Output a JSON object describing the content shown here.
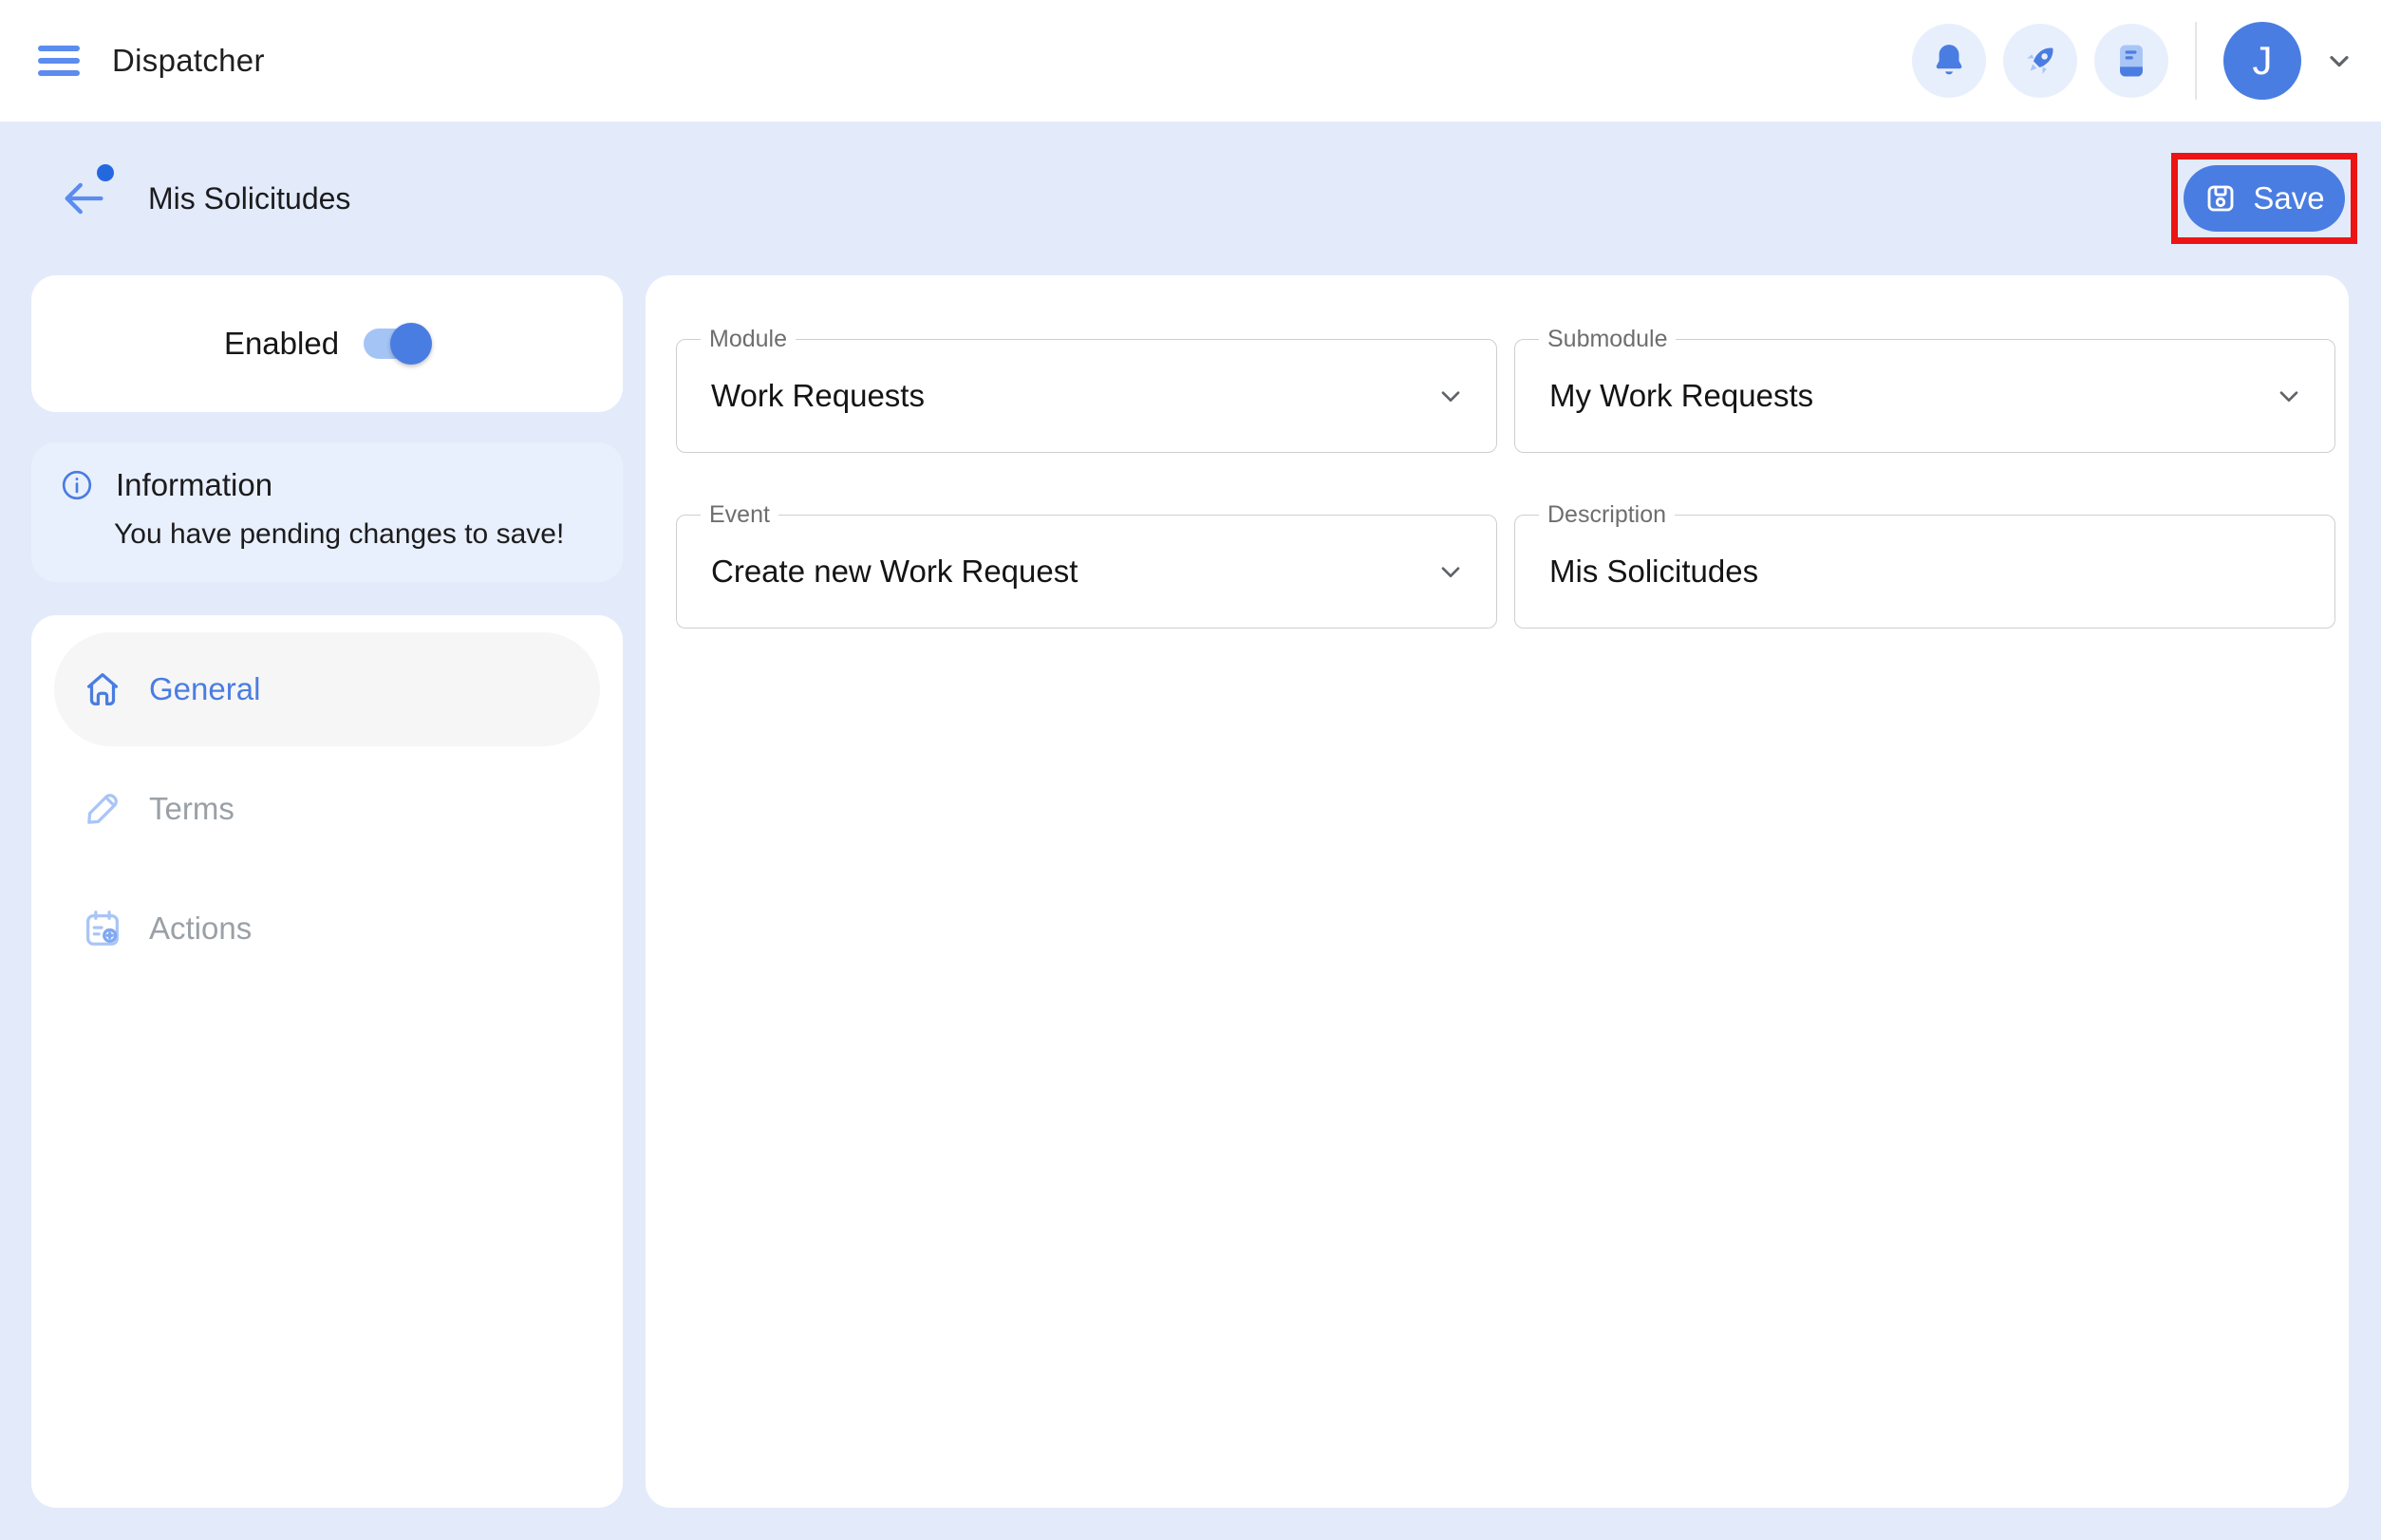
{
  "app": {
    "title": "Dispatcher",
    "avatar_initial": "J"
  },
  "page": {
    "title": "Mis Solicitudes",
    "save_button": "Save"
  },
  "sidebar": {
    "enabled_toggle": {
      "label": "Enabled",
      "state": "on"
    },
    "info_card": {
      "title": "Information",
      "message": "You have pending changes to save!"
    },
    "nav": {
      "items": [
        {
          "label": "General",
          "icon": "home-icon",
          "active": true
        },
        {
          "label": "Terms",
          "icon": "pencil-icon",
          "active": false
        },
        {
          "label": "Actions",
          "icon": "calendar-plus-icon",
          "active": false
        }
      ]
    }
  },
  "form": {
    "fields": [
      {
        "label": "Module",
        "value": "Work Requests",
        "control": "select"
      },
      {
        "label": "Submodule",
        "value": "My Work Requests",
        "control": "select"
      },
      {
        "label": "Event",
        "value": "Create new Work Request",
        "control": "select"
      },
      {
        "label": "Description",
        "value": "Mis Solicitudes",
        "control": "text-input"
      }
    ]
  },
  "icons": {
    "appbar": [
      "menu-icon",
      "notifications-bell-icon",
      "rocket-icon",
      "journal-icon",
      "chevron-down-icon"
    ],
    "page": [
      "back-arrow-icon",
      "notification-dot",
      "save-floppy-icon",
      "info-icon"
    ]
  },
  "colors": {
    "accent_blue": "#4A7DE2",
    "accent_blue_light": "#5B8CEE",
    "icon_chip_bg": "#E8EFFC",
    "page_bg": "#E3EBFB",
    "info_card_bg": "#E9F0FD",
    "active_nav_bg": "#F6F6F6",
    "muted_text": "#9AA0A6",
    "annotation_red": "#EC1414"
  }
}
